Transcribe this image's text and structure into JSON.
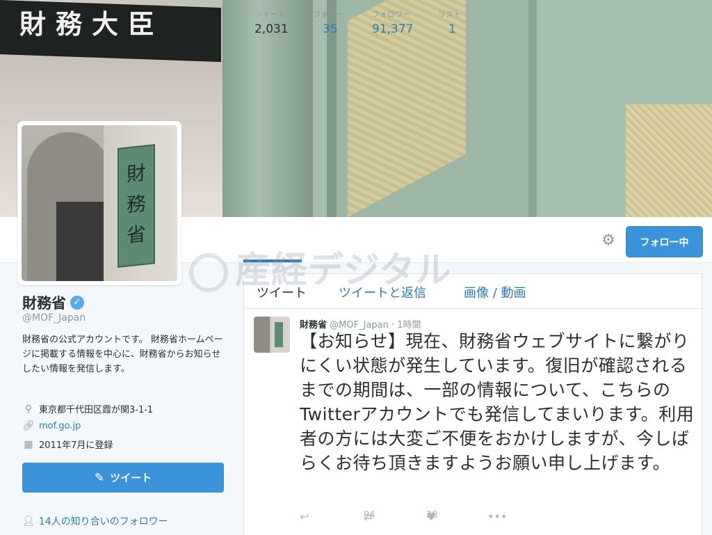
{
  "banner": {
    "sign": "財務大臣"
  },
  "profile": {
    "plaque": "財務省",
    "name": "財務省",
    "screen_name": "@MOF_Japan",
    "bio": "財務省の公式アカウントです。 財務省ホームページに掲載する情報を中心に、財務省からお知らせしたい情報を発信します。",
    "location": "東京都千代田区霞が関3-1-1",
    "url": "mof.go.jp",
    "joined": "2011年7月に登録",
    "tweet_button": "ツイート",
    "followers_you_know": "14人の知り合いのフォロワー"
  },
  "stats": [
    {
      "label": "ツイート",
      "value": "2,031"
    },
    {
      "label": "フォロー",
      "value": "35"
    },
    {
      "label": "フォロワー",
      "value": "91,377"
    },
    {
      "label": "リスト",
      "value": "1"
    }
  ],
  "follow_button": "フォロー中",
  "watermark": "産経デジタル",
  "timeline": {
    "tabs": [
      "ツイート",
      "ツイートと返信",
      "画像 / 動画"
    ],
    "tweet": {
      "name": "財務省",
      "handle": "@MOF_Japan",
      "time": "· 1時間",
      "text": "【お知らせ】現在、財務省ウェブサイトに繋がりにくい状態が発生しています。復旧が確認されるまでの期間は、一部の情報について、こちらのTwitterアカウントでも発信してまいります。利用者の方には大変ご不便をおかけしますが、今しばらくお待ち頂きますようお願い申し上げます。",
      "retweets": "94",
      "likes": "28"
    }
  },
  "icons": {
    "verified": "verified-badge-icon",
    "location": "location-pin-icon",
    "link": "link-icon",
    "calendar": "calendar-icon",
    "gear": "gear-icon",
    "compose": "compose-tweet-icon",
    "person": "person-icon",
    "reply": "reply-icon",
    "retweet": "retweet-icon",
    "like": "heart-icon",
    "more": "more-icon"
  },
  "colors": {
    "accent": "#2b7bb9",
    "button": "#3b94d9",
    "verified": "#55acee"
  }
}
